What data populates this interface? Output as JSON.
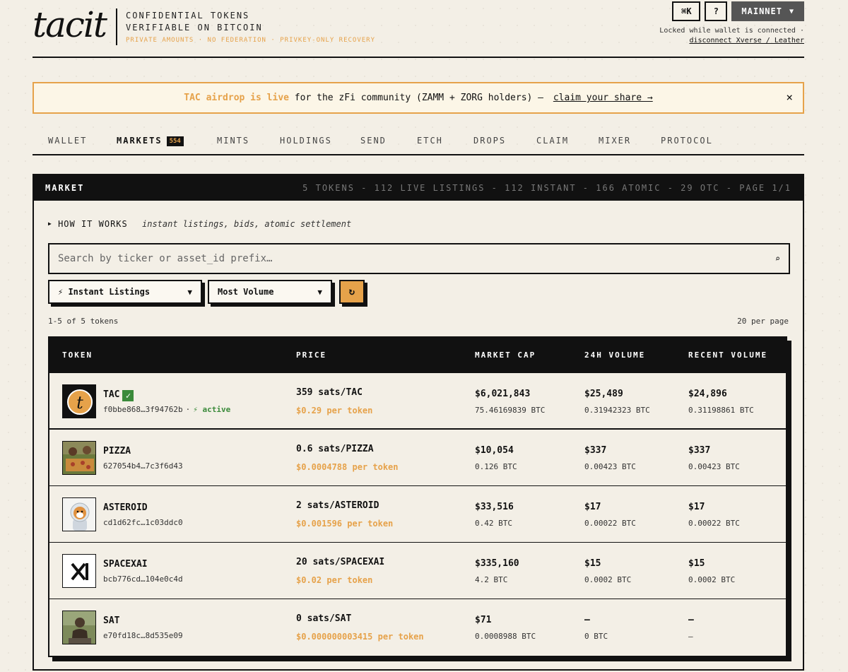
{
  "header": {
    "logo": "tacit",
    "tagline_1": "CONFIDENTIAL TOKENS",
    "tagline_2": "VERIFIABLE ON BITCOIN",
    "tagline_3": "PRIVATE AMOUNTS · NO FEDERATION · PRIVKEY-ONLY RECOVERY",
    "cmd_k": "⌘K",
    "help": "?",
    "network": "MAINNET",
    "lock_note": "Locked while wallet is connected ·",
    "disconnect_link": "disconnect Xverse / Leather"
  },
  "banner": {
    "highlight": "TAC airdrop is live",
    "text": " for the zFi community (ZAMM + ZORG holders) — ",
    "link": "claim your share →",
    "close": "×"
  },
  "nav": {
    "items": [
      "WALLET",
      "MARKETS",
      "MINTS",
      "HOLDINGS",
      "SEND",
      "ETCH",
      "DROPS",
      "CLAIM",
      "MIXER",
      "PROTOCOL"
    ],
    "markets_badge": "554",
    "active": "MARKETS"
  },
  "market": {
    "title": "MARKET",
    "stats": "5 TOKENS - 112 LIVE LISTINGS - 112 INSTANT - 166 ATOMIC - 29 OTC - PAGE 1/1",
    "how_label": "HOW IT WORKS",
    "how_sub": "instant listings, bids, atomic settlement",
    "search_placeholder": "Search by ticker or asset_id prefix…",
    "filter_value": "⚡ Instant Listings",
    "sort_value": "Most Volume",
    "refresh": "↻",
    "count_text": "1-5 of 5 tokens",
    "per_page": "20 per page",
    "columns": [
      "TOKEN",
      "PRICE",
      "MARKET CAP",
      "24H VOLUME",
      "RECENT VOLUME"
    ],
    "rows": [
      {
        "ticker": "TAC",
        "id": "f0bbe868…3f94762b",
        "status": "⚡ active",
        "verified": "✓",
        "price": "359 sats/TAC",
        "usd": "$0.29 per token",
        "mcap": "$6,021,843",
        "mcap_btc": "75.46169839 BTC",
        "vol24": "$25,489",
        "vol24_btc": "0.31942323 BTC",
        "recent": "$24,896",
        "recent_btc": "0.31198861 BTC"
      },
      {
        "ticker": "PIZZA",
        "id": "627054b4…7c3f6d43",
        "price": "0.6 sats/PIZZA",
        "usd": "$0.0004788 per token",
        "mcap": "$10,054",
        "mcap_btc": "0.126 BTC",
        "vol24": "$337",
        "vol24_btc": "0.00423 BTC",
        "recent": "$337",
        "recent_btc": "0.00423 BTC"
      },
      {
        "ticker": "ASTEROID",
        "id": "cd1d62fc…1c03ddc0",
        "price": "2 sats/ASTEROID",
        "usd": "$0.001596 per token",
        "mcap": "$33,516",
        "mcap_btc": "0.42 BTC",
        "vol24": "$17",
        "vol24_btc": "0.00022 BTC",
        "recent": "$17",
        "recent_btc": "0.00022 BTC"
      },
      {
        "ticker": "SPACEXAI",
        "id": "bcb776cd…104e0c4d",
        "price": "20 sats/SPACEXAI",
        "usd": "$0.02 per token",
        "mcap": "$335,160",
        "mcap_btc": "4.2 BTC",
        "vol24": "$15",
        "vol24_btc": "0.0002 BTC",
        "recent": "$15",
        "recent_btc": "0.0002 BTC"
      },
      {
        "ticker": "SAT",
        "id": "e70fd18c…8d535e09",
        "price": "0 sats/SAT",
        "usd": "$0.000000003415 per token",
        "mcap": "$71",
        "mcap_btc": "0.0008988 BTC",
        "vol24": "—",
        "vol24_btc": "0 BTC",
        "recent": "—",
        "recent_btc": "—"
      }
    ]
  },
  "colors": {
    "accent": "#e6a24a",
    "dark": "#111111",
    "background": "#f3efe6",
    "active_green": "#3a8a3a"
  }
}
